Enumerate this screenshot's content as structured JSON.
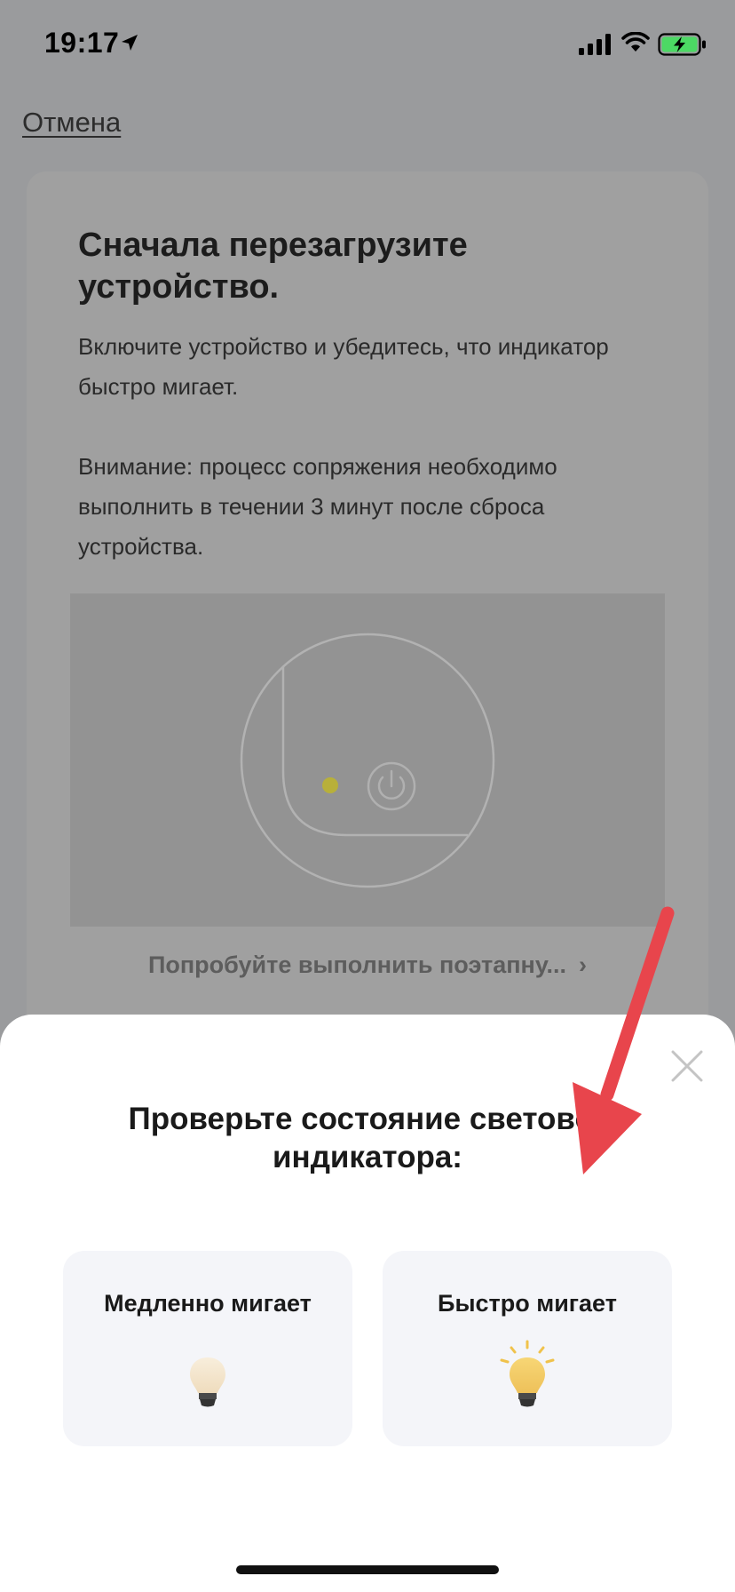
{
  "status_bar": {
    "time": "19:17"
  },
  "nav": {
    "cancel_label": "Отмена"
  },
  "card": {
    "title": "Сначала перезагрузите устройство.",
    "description": "Включите устройство и убедитесь, что индикатор быстро мигает.",
    "note": "Внимание: процесс сопряжения необходимо выполнить в течении 3 минут после сброса устройства.",
    "step_link_label": "Попробуйте выполнить поэтапну...",
    "step_link_chevron": "›"
  },
  "sheet": {
    "title_line1": "Проверьте состояние световог",
    "title_line2": "индикатора:",
    "options": [
      {
        "label": "Медленно мигает",
        "icon": "dim-bulb-icon"
      },
      {
        "label": "Быстро мигает",
        "icon": "bright-bulb-icon"
      }
    ]
  },
  "colors": {
    "overlay_background": "#9a9b9d",
    "annotation_arrow": "#e8454c",
    "bulb_bright": "#f5c242",
    "bulb_dim": "#f3e6cf",
    "option_background": "#f4f5f9"
  }
}
